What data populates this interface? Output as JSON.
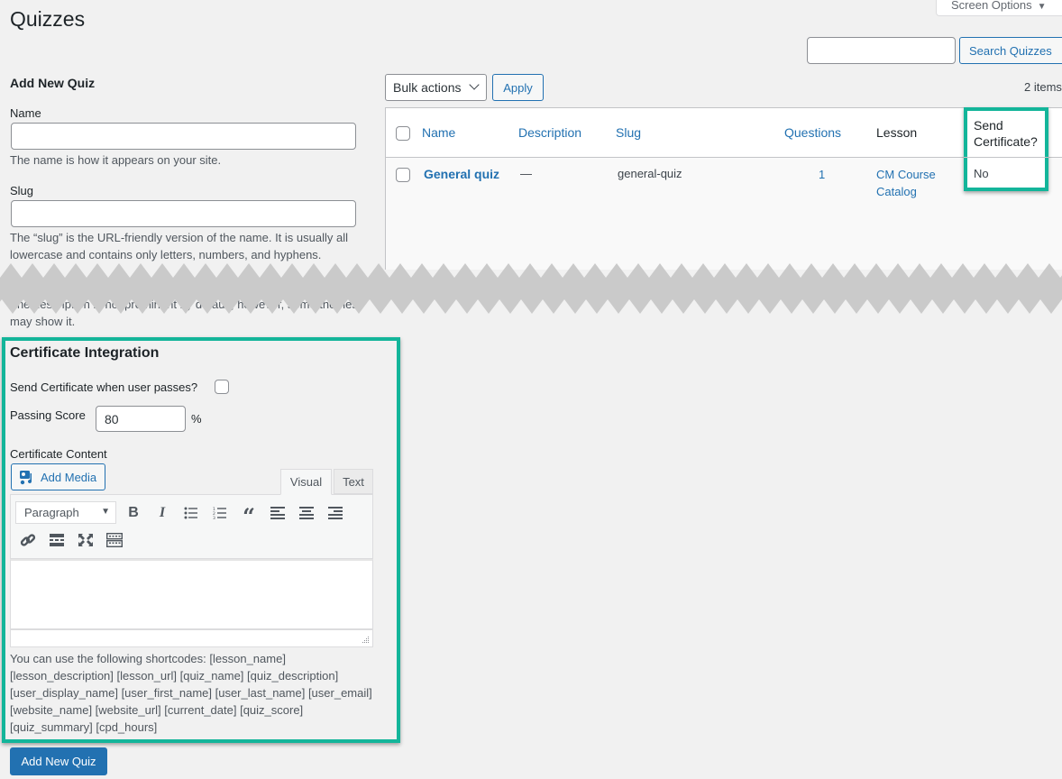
{
  "page": {
    "title": "Quizzes",
    "screen_options_label": "Screen Options"
  },
  "search": {
    "value": "",
    "button_label": "Search Quizzes"
  },
  "form": {
    "heading": "Add New Quiz",
    "name_label": "Name",
    "name_value": "",
    "name_help": "The name is how it appears on your site.",
    "slug_label": "Slug",
    "slug_value": "",
    "slug_help": "The “slug” is the URL-friendly version of the name. It is usually all lowercase and contains only letters, numbers, and hyphens.",
    "description_help": "The description is not prominent by default; however, some themes may show it.",
    "submit_label": "Add New Quiz"
  },
  "certificate": {
    "heading": "Certificate Integration",
    "send_label": "Send Certificate when user passes?",
    "send_checked": false,
    "passing_score_label": "Passing Score",
    "passing_score_value": "80",
    "percent_symbol": "%",
    "content_label": "Certificate Content",
    "add_media_label": "Add Media",
    "tabs": [
      {
        "label": "Visual",
        "active": true
      },
      {
        "label": "Text",
        "active": false
      }
    ],
    "format_select_value": "Paragraph",
    "toolbar_icons": [
      "bold-icon",
      "italic-icon",
      "bulleted-list-icon",
      "numbered-list-icon",
      "blockquote-icon",
      "align-left-icon",
      "align-center-icon",
      "align-right-icon",
      "link-icon",
      "read-more-icon",
      "fullscreen-icon",
      "toolbar-toggle-icon"
    ],
    "shortcodes_text": "You can use the following shortcodes: [lesson_name] [lesson_description] [lesson_url] [quiz_name] [quiz_description] [user_display_name] [user_first_name] [user_last_name] [user_email] [website_name] [website_url] [current_date] [quiz_score] [quiz_summary] [cpd_hours]"
  },
  "list": {
    "bulk_actions_label": "Bulk actions",
    "apply_label": "Apply",
    "items_count": "2 items",
    "columns": [
      {
        "label": "Name",
        "sortable": true
      },
      {
        "label": "Description",
        "sortable": true
      },
      {
        "label": "Slug",
        "sortable": true
      },
      {
        "label": "Questions",
        "sortable": true
      },
      {
        "label": "Lesson",
        "sortable": false
      },
      {
        "label": "Send Certificate?",
        "sortable": false
      }
    ],
    "rows": [
      {
        "name": "General quiz",
        "description": "—",
        "slug": "general-quiz",
        "questions": "1",
        "lesson": "CM Course Catalog",
        "send_certificate": "No"
      }
    ]
  },
  "colors": {
    "highlight": "#13b59a",
    "link": "#2271b1",
    "primary_button": "#2271b1"
  }
}
